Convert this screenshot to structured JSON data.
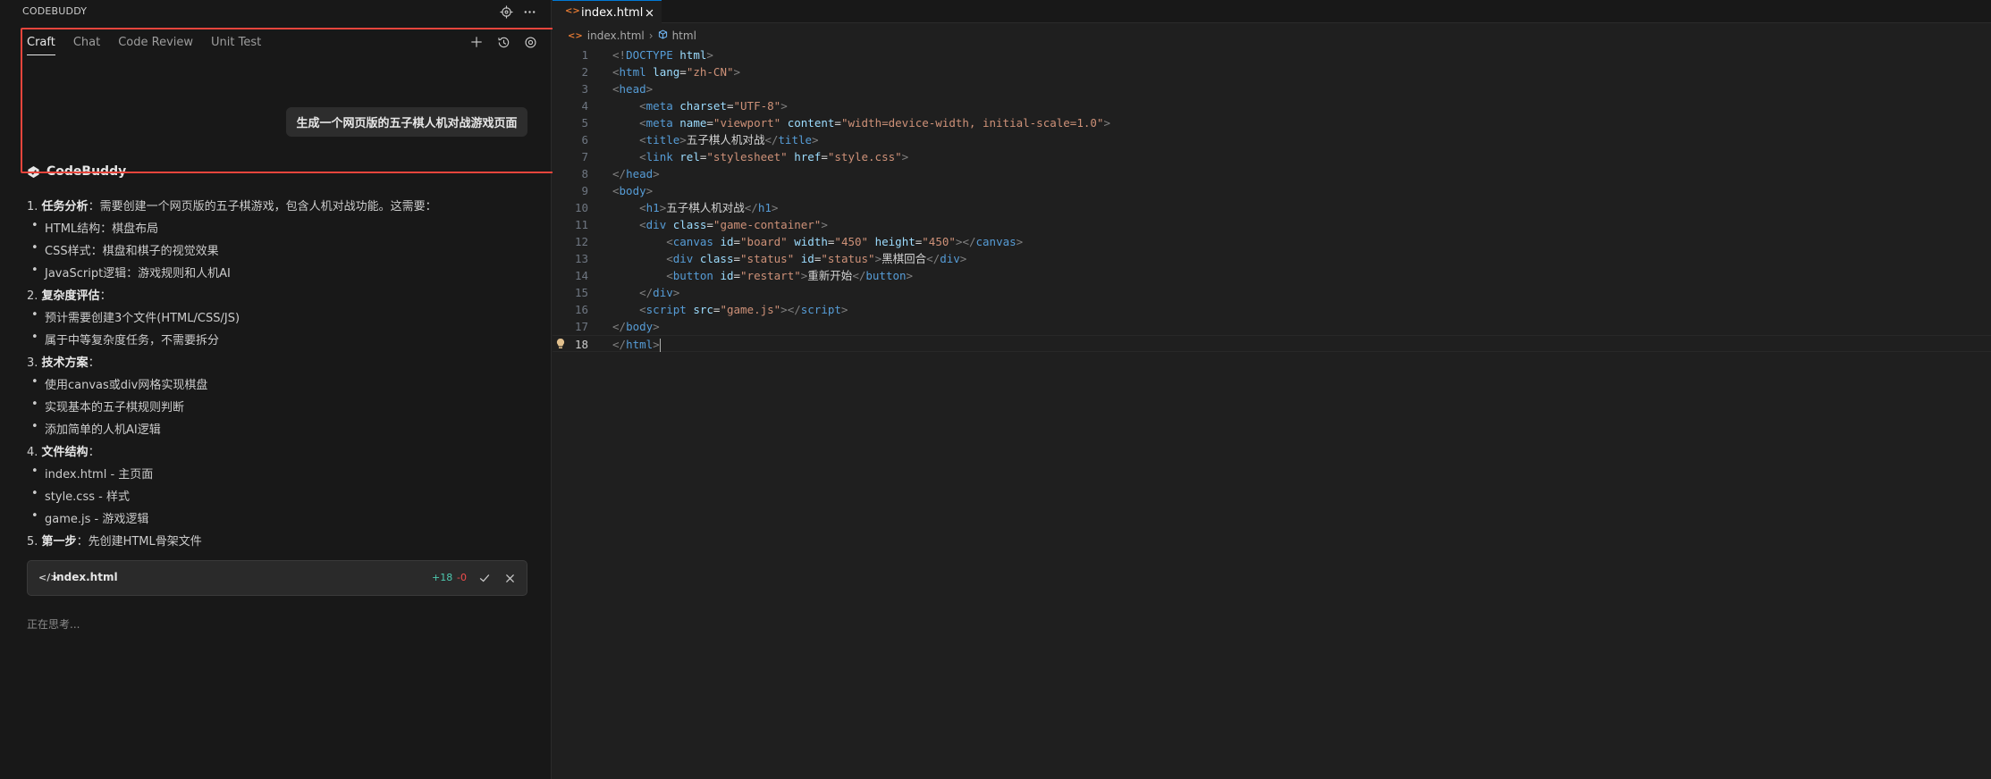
{
  "sidebar": {
    "title": "CODEBUDDY",
    "tabs": [
      {
        "label": "Craft",
        "active": true
      },
      {
        "label": "Chat",
        "active": false
      },
      {
        "label": "Code Review",
        "active": false
      },
      {
        "label": "Unit Test",
        "active": false
      }
    ],
    "icons": {
      "header": [
        "target-icon",
        "more-icon"
      ],
      "tab_actions": [
        "plus-icon",
        "history-icon",
        "settings-icon"
      ]
    }
  },
  "chat": {
    "user_message": "生成一个网页版的五子棋人机对战游戏页面",
    "assistant_name": "CodeBuddy",
    "response": [
      {
        "kind": "numbered",
        "num": "1.",
        "bold": "任务分析",
        "text": "：需要创建一个网页版的五子棋游戏，包含人机对战功能。这需要："
      },
      {
        "kind": "bullet",
        "text": "HTML结构：棋盘布局"
      },
      {
        "kind": "bullet",
        "text": "CSS样式：棋盘和棋子的视觉效果"
      },
      {
        "kind": "bullet",
        "text": "JavaScript逻辑：游戏规则和人机AI"
      },
      {
        "kind": "numbered",
        "num": "2.",
        "bold": "复杂度评估",
        "text": "："
      },
      {
        "kind": "bullet",
        "text": "预计需要创建3个文件(HTML/CSS/JS)"
      },
      {
        "kind": "bullet",
        "text": "属于中等复杂度任务，不需要拆分"
      },
      {
        "kind": "numbered",
        "num": "3.",
        "bold": "技术方案",
        "text": "："
      },
      {
        "kind": "bullet",
        "text": "使用canvas或div网格实现棋盘"
      },
      {
        "kind": "bullet",
        "text": "实现基本的五子棋规则判断"
      },
      {
        "kind": "bullet",
        "text": "添加简单的人机AI逻辑"
      },
      {
        "kind": "numbered",
        "num": "4.",
        "bold": "文件结构",
        "text": "："
      },
      {
        "kind": "bullet",
        "text": "index.html - 主页面"
      },
      {
        "kind": "bullet",
        "text": "style.css - 样式"
      },
      {
        "kind": "bullet",
        "text": "game.js - 游戏逻辑"
      },
      {
        "kind": "numbered",
        "num": "5.",
        "bold": "第一步",
        "text": "：先创建HTML骨架文件"
      }
    ],
    "file_card": {
      "icon": "</>",
      "name": "index.html",
      "additions": "+18",
      "deletions": "-0"
    },
    "status": "正在思考..."
  },
  "editor": {
    "tab": {
      "icon": "<>",
      "name": "index.html"
    },
    "breadcrumb": {
      "file": "index.html",
      "element": "html"
    },
    "current_line": 18,
    "lines": [
      [
        [
          "br",
          "<!"
        ],
        [
          "tag",
          "DOCTYPE"
        ],
        [
          "txt",
          " "
        ],
        [
          "attr",
          "html"
        ],
        [
          "br",
          ">"
        ]
      ],
      [
        [
          "br",
          "<"
        ],
        [
          "tag",
          "html"
        ],
        [
          "txt",
          " "
        ],
        [
          "attr",
          "lang"
        ],
        [
          "txt",
          "="
        ],
        [
          "str",
          "\"zh-CN\""
        ],
        [
          "br",
          ">"
        ]
      ],
      [
        [
          "br",
          "<"
        ],
        [
          "tag",
          "head"
        ],
        [
          "br",
          ">"
        ]
      ],
      [
        [
          "txt",
          "    "
        ],
        [
          "br",
          "<"
        ],
        [
          "tag",
          "meta"
        ],
        [
          "txt",
          " "
        ],
        [
          "attr",
          "charset"
        ],
        [
          "txt",
          "="
        ],
        [
          "str",
          "\"UTF-8\""
        ],
        [
          "br",
          ">"
        ]
      ],
      [
        [
          "txt",
          "    "
        ],
        [
          "br",
          "<"
        ],
        [
          "tag",
          "meta"
        ],
        [
          "txt",
          " "
        ],
        [
          "attr",
          "name"
        ],
        [
          "txt",
          "="
        ],
        [
          "str",
          "\"viewport\""
        ],
        [
          "txt",
          " "
        ],
        [
          "attr",
          "content"
        ],
        [
          "txt",
          "="
        ],
        [
          "str",
          "\"width=device-width, initial-scale=1.0\""
        ],
        [
          "br",
          ">"
        ]
      ],
      [
        [
          "txt",
          "    "
        ],
        [
          "br",
          "<"
        ],
        [
          "tag",
          "title"
        ],
        [
          "br",
          ">"
        ],
        [
          "txt",
          "五子棋人机对战"
        ],
        [
          "br",
          "</"
        ],
        [
          "tag",
          "title"
        ],
        [
          "br",
          ">"
        ]
      ],
      [
        [
          "txt",
          "    "
        ],
        [
          "br",
          "<"
        ],
        [
          "tag",
          "link"
        ],
        [
          "txt",
          " "
        ],
        [
          "attr",
          "rel"
        ],
        [
          "txt",
          "="
        ],
        [
          "str",
          "\"stylesheet\""
        ],
        [
          "txt",
          " "
        ],
        [
          "attr",
          "href"
        ],
        [
          "txt",
          "="
        ],
        [
          "str",
          "\"style.css\""
        ],
        [
          "br",
          ">"
        ]
      ],
      [
        [
          "br",
          "</"
        ],
        [
          "tag",
          "head"
        ],
        [
          "br",
          ">"
        ]
      ],
      [
        [
          "br",
          "<"
        ],
        [
          "tag",
          "body"
        ],
        [
          "br",
          ">"
        ]
      ],
      [
        [
          "txt",
          "    "
        ],
        [
          "br",
          "<"
        ],
        [
          "tag",
          "h1"
        ],
        [
          "br",
          ">"
        ],
        [
          "txt",
          "五子棋人机对战"
        ],
        [
          "br",
          "</"
        ],
        [
          "tag",
          "h1"
        ],
        [
          "br",
          ">"
        ]
      ],
      [
        [
          "txt",
          "    "
        ],
        [
          "br",
          "<"
        ],
        [
          "tag",
          "div"
        ],
        [
          "txt",
          " "
        ],
        [
          "attr",
          "class"
        ],
        [
          "txt",
          "="
        ],
        [
          "str",
          "\"game-container\""
        ],
        [
          "br",
          ">"
        ]
      ],
      [
        [
          "txt",
          "        "
        ],
        [
          "br",
          "<"
        ],
        [
          "tag",
          "canvas"
        ],
        [
          "txt",
          " "
        ],
        [
          "attr",
          "id"
        ],
        [
          "txt",
          "="
        ],
        [
          "str",
          "\"board\""
        ],
        [
          "txt",
          " "
        ],
        [
          "attr",
          "width"
        ],
        [
          "txt",
          "="
        ],
        [
          "str",
          "\"450\""
        ],
        [
          "txt",
          " "
        ],
        [
          "attr",
          "height"
        ],
        [
          "txt",
          "="
        ],
        [
          "str",
          "\"450\""
        ],
        [
          "br",
          "></"
        ],
        [
          "tag",
          "canvas"
        ],
        [
          "br",
          ">"
        ]
      ],
      [
        [
          "txt",
          "        "
        ],
        [
          "br",
          "<"
        ],
        [
          "tag",
          "div"
        ],
        [
          "txt",
          " "
        ],
        [
          "attr",
          "class"
        ],
        [
          "txt",
          "="
        ],
        [
          "str",
          "\"status\""
        ],
        [
          "txt",
          " "
        ],
        [
          "attr",
          "id"
        ],
        [
          "txt",
          "="
        ],
        [
          "str",
          "\"status\""
        ],
        [
          "br",
          ">"
        ],
        [
          "txt",
          "黑棋回合"
        ],
        [
          "br",
          "</"
        ],
        [
          "tag",
          "div"
        ],
        [
          "br",
          ">"
        ]
      ],
      [
        [
          "txt",
          "        "
        ],
        [
          "br",
          "<"
        ],
        [
          "tag",
          "button"
        ],
        [
          "txt",
          " "
        ],
        [
          "attr",
          "id"
        ],
        [
          "txt",
          "="
        ],
        [
          "str",
          "\"restart\""
        ],
        [
          "br",
          ">"
        ],
        [
          "txt",
          "重新开始"
        ],
        [
          "br",
          "</"
        ],
        [
          "tag",
          "button"
        ],
        [
          "br",
          ">"
        ]
      ],
      [
        [
          "txt",
          "    "
        ],
        [
          "br",
          "</"
        ],
        [
          "tag",
          "div"
        ],
        [
          "br",
          ">"
        ]
      ],
      [
        [
          "txt",
          "    "
        ],
        [
          "br",
          "<"
        ],
        [
          "tag",
          "script"
        ],
        [
          "txt",
          " "
        ],
        [
          "attr",
          "src"
        ],
        [
          "txt",
          "="
        ],
        [
          "str",
          "\"game.js\""
        ],
        [
          "br",
          "></"
        ],
        [
          "tag",
          "script"
        ],
        [
          "br",
          ">"
        ]
      ],
      [
        [
          "br",
          "</"
        ],
        [
          "tag",
          "body"
        ],
        [
          "br",
          ">"
        ]
      ],
      [
        [
          "br",
          "</"
        ],
        [
          "tag",
          "html"
        ],
        [
          "br",
          ">"
        ]
      ]
    ]
  },
  "colors": {
    "highlight": "#e8453c",
    "accent": "#0078d4",
    "added": "#4ec9b0",
    "deleted": "#f14c4c"
  }
}
